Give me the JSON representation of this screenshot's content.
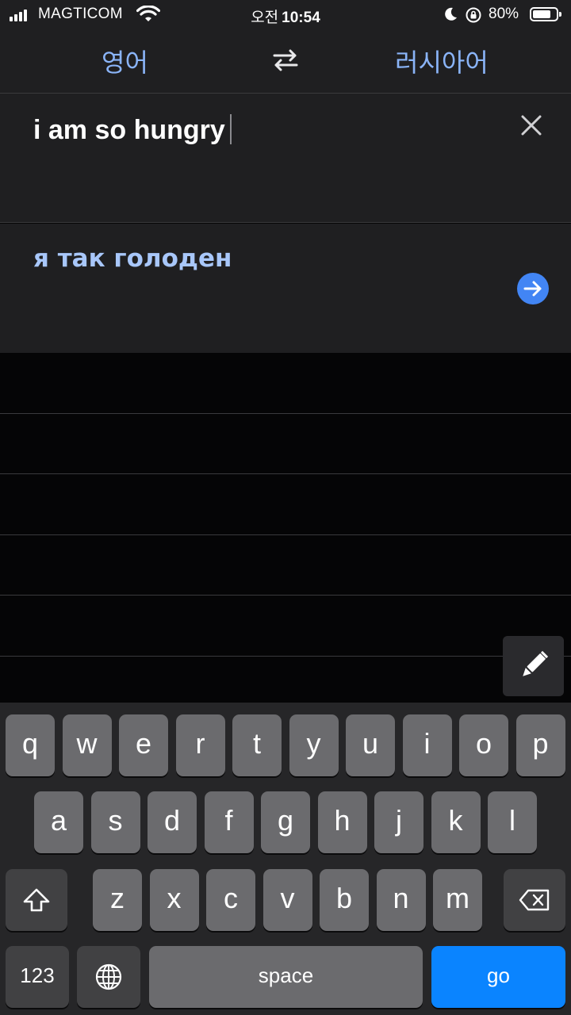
{
  "status_bar": {
    "carrier": "MAGTICOM",
    "time_ampm": "오전",
    "time": "10:54",
    "battery": "80%",
    "battery_level": 0.8,
    "icons": [
      "signal-icon",
      "wifi-icon",
      "moon-icon",
      "rotation-lock-icon",
      "battery-icon"
    ]
  },
  "language_bar": {
    "source_language": "영어",
    "target_language": "러시아어",
    "swap_icon": "swap-arrows-icon"
  },
  "input": {
    "text": "i am so hungry",
    "clear_icon": "close-icon"
  },
  "output": {
    "text": "я так голоден",
    "go_icon": "arrow-right-circle-icon",
    "accent": "#4285f4"
  },
  "pen_button": {
    "icon": "pen-icon"
  },
  "keyboard": {
    "row1": [
      "q",
      "w",
      "e",
      "r",
      "t",
      "y",
      "u",
      "i",
      "o",
      "p"
    ],
    "row2": [
      "a",
      "s",
      "d",
      "f",
      "g",
      "h",
      "j",
      "k",
      "l"
    ],
    "row3": [
      "z",
      "x",
      "c",
      "v",
      "b",
      "n",
      "m"
    ],
    "numbers": "123",
    "space": "space",
    "go": "go",
    "shift_icon": "shift-icon",
    "delete_icon": "backspace-icon",
    "globe_icon": "globe-icon",
    "go_color": "#0a84ff"
  }
}
